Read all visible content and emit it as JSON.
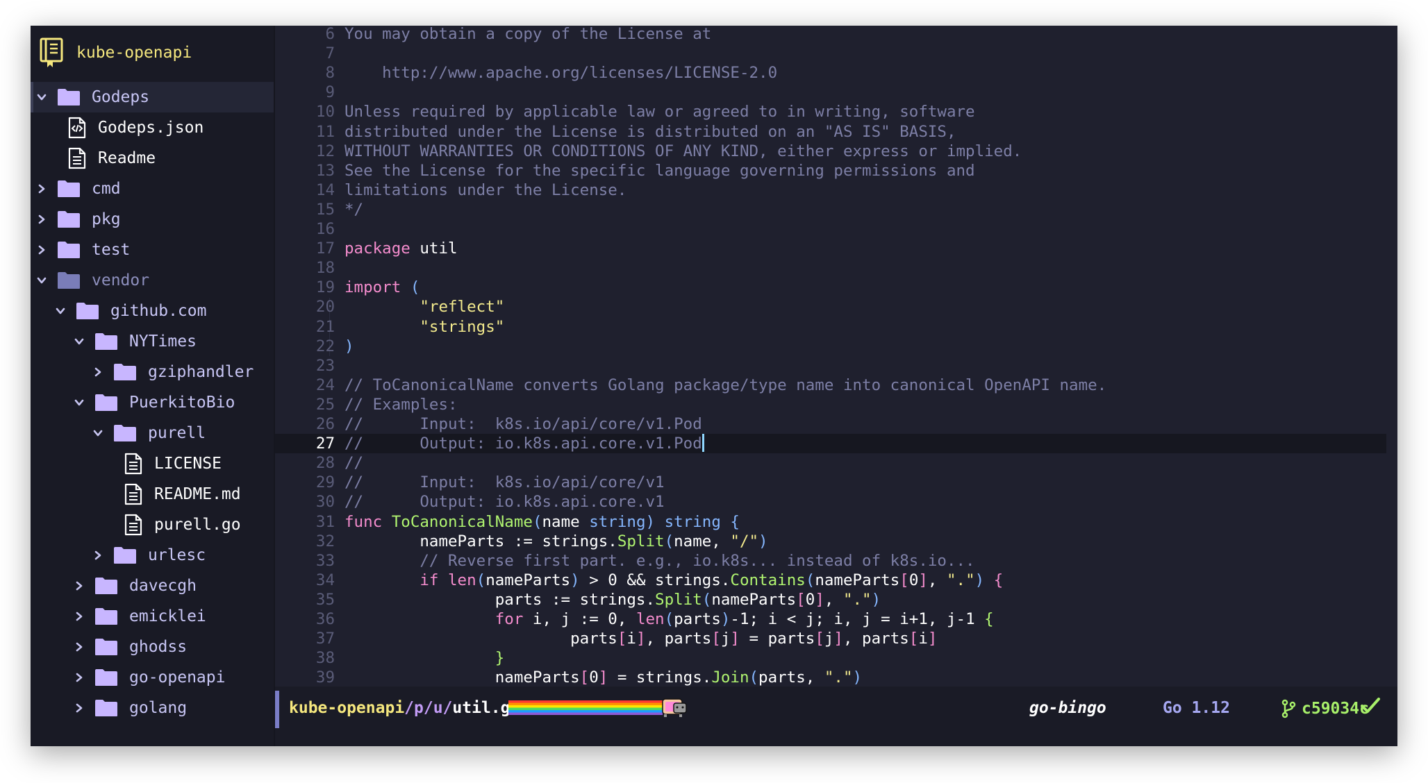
{
  "project": {
    "name": "kube-openapi",
    "icon": "repo-book-icon"
  },
  "tree": [
    {
      "label": "Godeps",
      "type": "folder",
      "depth": 0,
      "expanded": true,
      "selected": true
    },
    {
      "label": "Godeps.json",
      "type": "file-code",
      "depth": 1
    },
    {
      "label": "Readme",
      "type": "file",
      "depth": 1
    },
    {
      "label": "cmd",
      "type": "folder",
      "depth": 0,
      "expanded": false
    },
    {
      "label": "pkg",
      "type": "folder",
      "depth": 0,
      "expanded": false
    },
    {
      "label": "test",
      "type": "folder",
      "depth": 0,
      "expanded": false
    },
    {
      "label": "vendor",
      "type": "folder",
      "depth": 0,
      "expanded": true,
      "dimmed": true
    },
    {
      "label": "github.com",
      "type": "folder",
      "depth": 1,
      "expanded": true
    },
    {
      "label": "NYTimes",
      "type": "folder",
      "depth": 2,
      "expanded": true
    },
    {
      "label": "gziphandler",
      "type": "folder",
      "depth": 3,
      "expanded": false
    },
    {
      "label": "PuerkitoBio",
      "type": "folder",
      "depth": 2,
      "expanded": true
    },
    {
      "label": "purell",
      "type": "folder",
      "depth": 3,
      "expanded": true
    },
    {
      "label": "LICENSE",
      "type": "file",
      "depth": 4
    },
    {
      "label": "README.md",
      "type": "file",
      "depth": 4
    },
    {
      "label": "purell.go",
      "type": "file",
      "depth": 4
    },
    {
      "label": "urlesc",
      "type": "folder",
      "depth": 3,
      "expanded": false
    },
    {
      "label": "davecgh",
      "type": "folder",
      "depth": 2,
      "expanded": false
    },
    {
      "label": "emicklei",
      "type": "folder",
      "depth": 2,
      "expanded": false
    },
    {
      "label": "ghodss",
      "type": "folder",
      "depth": 2,
      "expanded": false
    },
    {
      "label": "go-openapi",
      "type": "folder",
      "depth": 2,
      "expanded": false
    },
    {
      "label": "golang",
      "type": "folder",
      "depth": 2,
      "expanded": false
    }
  ],
  "editor": {
    "current_line": 27,
    "lines": [
      {
        "n": 6,
        "tokens": [
          [
            "cm",
            "You may obtain a copy of the License at"
          ]
        ]
      },
      {
        "n": 7,
        "tokens": []
      },
      {
        "n": 8,
        "tokens": [
          [
            "cm",
            "    http://www.apache.org/licenses/LICENSE-2.0"
          ]
        ]
      },
      {
        "n": 9,
        "tokens": []
      },
      {
        "n": 10,
        "tokens": [
          [
            "cm",
            "Unless required by applicable law or agreed to in writing, software"
          ]
        ]
      },
      {
        "n": 11,
        "tokens": [
          [
            "cm",
            "distributed under the License is distributed on an \"AS IS\" BASIS,"
          ]
        ]
      },
      {
        "n": 12,
        "tokens": [
          [
            "cm",
            "WITHOUT WARRANTIES OR CONDITIONS OF ANY KIND, either express or implied."
          ]
        ]
      },
      {
        "n": 13,
        "tokens": [
          [
            "cm",
            "See the License for the specific language governing permissions and"
          ]
        ]
      },
      {
        "n": 14,
        "tokens": [
          [
            "cm",
            "limitations under the License."
          ]
        ]
      },
      {
        "n": 15,
        "tokens": [
          [
            "cm",
            "*/"
          ]
        ]
      },
      {
        "n": 16,
        "tokens": []
      },
      {
        "n": 17,
        "tokens": [
          [
            "kw",
            "package"
          ],
          [
            "tx",
            " util"
          ]
        ]
      },
      {
        "n": 18,
        "tokens": []
      },
      {
        "n": 19,
        "tokens": [
          [
            "kw",
            "import"
          ],
          [
            "tx",
            " "
          ],
          [
            "pu",
            "("
          ]
        ]
      },
      {
        "n": 20,
        "tokens": [
          [
            "tx",
            "        "
          ],
          [
            "st",
            "\"reflect\""
          ]
        ]
      },
      {
        "n": 21,
        "tokens": [
          [
            "tx",
            "        "
          ],
          [
            "st",
            "\"strings\""
          ]
        ]
      },
      {
        "n": 22,
        "tokens": [
          [
            "pu",
            ")"
          ]
        ]
      },
      {
        "n": 23,
        "tokens": []
      },
      {
        "n": 24,
        "tokens": [
          [
            "cm",
            "// ToCanonicalName converts Golang package/type name into canonical OpenAPI name."
          ]
        ]
      },
      {
        "n": 25,
        "tokens": [
          [
            "cm",
            "// Examples:"
          ]
        ]
      },
      {
        "n": 26,
        "tokens": [
          [
            "cm",
            "//      Input:  k8s.io/api/core/v1.Pod"
          ]
        ]
      },
      {
        "n": 27,
        "tokens": [
          [
            "cm",
            "//      Output: io.k8s.api.core.v1.Pod"
          ]
        ],
        "cursor": true
      },
      {
        "n": 28,
        "tokens": [
          [
            "cm",
            "//"
          ]
        ]
      },
      {
        "n": 29,
        "tokens": [
          [
            "cm",
            "//      Input:  k8s.io/api/core/v1"
          ]
        ]
      },
      {
        "n": 30,
        "tokens": [
          [
            "cm",
            "//      Output: io.k8s.api.core.v1"
          ]
        ]
      },
      {
        "n": 31,
        "tokens": [
          [
            "kw",
            "func"
          ],
          [
            "tx",
            " "
          ],
          [
            "fn",
            "ToCanonicalName"
          ],
          [
            "pu",
            "("
          ],
          [
            "tx",
            "name "
          ],
          [
            "ty",
            "string"
          ],
          [
            "pu",
            ")"
          ],
          [
            "tx",
            " "
          ],
          [
            "ty",
            "string"
          ],
          [
            "tx",
            " "
          ],
          [
            "pu",
            "{"
          ]
        ]
      },
      {
        "n": 32,
        "tokens": [
          [
            "tx",
            "        nameParts := strings."
          ],
          [
            "fn",
            "Split"
          ],
          [
            "pu",
            "("
          ],
          [
            "tx",
            "name, "
          ],
          [
            "st",
            "\"/\""
          ],
          [
            "pu",
            ")"
          ]
        ]
      },
      {
        "n": 33,
        "tokens": [
          [
            "tx",
            "        "
          ],
          [
            "cm",
            "// Reverse first part. e.g., io.k8s... instead of k8s.io..."
          ]
        ]
      },
      {
        "n": 34,
        "tokens": [
          [
            "tx",
            "        "
          ],
          [
            "kw",
            "if"
          ],
          [
            "tx",
            " "
          ],
          [
            "kw",
            "len"
          ],
          [
            "pu",
            "("
          ],
          [
            "tx",
            "nameParts"
          ],
          [
            "pu",
            ")"
          ],
          [
            "tx",
            " > 0 && strings."
          ],
          [
            "fn",
            "Contains"
          ],
          [
            "pu",
            "("
          ],
          [
            "tx",
            "nameParts"
          ],
          [
            "kw",
            "["
          ],
          [
            "tx",
            "0"
          ],
          [
            "kw",
            "]"
          ],
          [
            "tx",
            ", "
          ],
          [
            "st",
            "\".\""
          ],
          [
            "pu",
            ")"
          ],
          [
            "tx",
            " "
          ],
          [
            "kw",
            "{"
          ]
        ]
      },
      {
        "n": 35,
        "tokens": [
          [
            "tx",
            "                parts := strings."
          ],
          [
            "fn",
            "Split"
          ],
          [
            "pu",
            "("
          ],
          [
            "tx",
            "nameParts"
          ],
          [
            "kw",
            "["
          ],
          [
            "tx",
            "0"
          ],
          [
            "kw",
            "]"
          ],
          [
            "tx",
            ", "
          ],
          [
            "st",
            "\".\""
          ],
          [
            "pu",
            ")"
          ]
        ]
      },
      {
        "n": 36,
        "tokens": [
          [
            "tx",
            "                "
          ],
          [
            "kw",
            "for"
          ],
          [
            "tx",
            " i, j := 0, "
          ],
          [
            "kw",
            "len"
          ],
          [
            "pu",
            "("
          ],
          [
            "tx",
            "parts"
          ],
          [
            "pu",
            ")"
          ],
          [
            "tx",
            "-1; i < j; i, j = i+1, j-1 "
          ],
          [
            "fn",
            "{"
          ]
        ]
      },
      {
        "n": 37,
        "tokens": [
          [
            "tx",
            "                        parts"
          ],
          [
            "kw",
            "["
          ],
          [
            "tx",
            "i"
          ],
          [
            "kw",
            "]"
          ],
          [
            "tx",
            ", parts"
          ],
          [
            "kw",
            "["
          ],
          [
            "tx",
            "j"
          ],
          [
            "kw",
            "]"
          ],
          [
            "tx",
            " = parts"
          ],
          [
            "kw",
            "["
          ],
          [
            "tx",
            "j"
          ],
          [
            "kw",
            "]"
          ],
          [
            "tx",
            ", parts"
          ],
          [
            "kw",
            "["
          ],
          [
            "tx",
            "i"
          ],
          [
            "kw",
            "]"
          ]
        ]
      },
      {
        "n": 38,
        "tokens": [
          [
            "tx",
            "                "
          ],
          [
            "fn",
            "}"
          ]
        ]
      },
      {
        "n": 39,
        "tokens": [
          [
            "tx",
            "                nameParts"
          ],
          [
            "kw",
            "["
          ],
          [
            "tx",
            "0"
          ],
          [
            "kw",
            "]"
          ],
          [
            "tx",
            " = strings."
          ],
          [
            "fn",
            "Join"
          ],
          [
            "pu",
            "("
          ],
          [
            "tx",
            "parts, "
          ],
          [
            "st",
            "\".\""
          ],
          [
            "pu",
            ")"
          ]
        ]
      }
    ]
  },
  "status": {
    "path_project": "kube-openapi",
    "path_dirs": "/p/u/",
    "path_file": "util.go",
    "progress_icon": "nyan-cat-progress",
    "theme": "go-bingo",
    "language": "Go 1.12",
    "branch_icon": "git-branch-icon",
    "commit": "c59034c",
    "status_icon": "check-icon"
  },
  "colors": {
    "background": "#1f202e",
    "sidebar": "#191a25",
    "folder": "#c8b6ff",
    "keyword": "#f48ccd",
    "function": "#b0f470",
    "type": "#86b7ff",
    "string": "#f3ea8d",
    "comment": "#7d7fa6",
    "project": "#f5e77e"
  }
}
